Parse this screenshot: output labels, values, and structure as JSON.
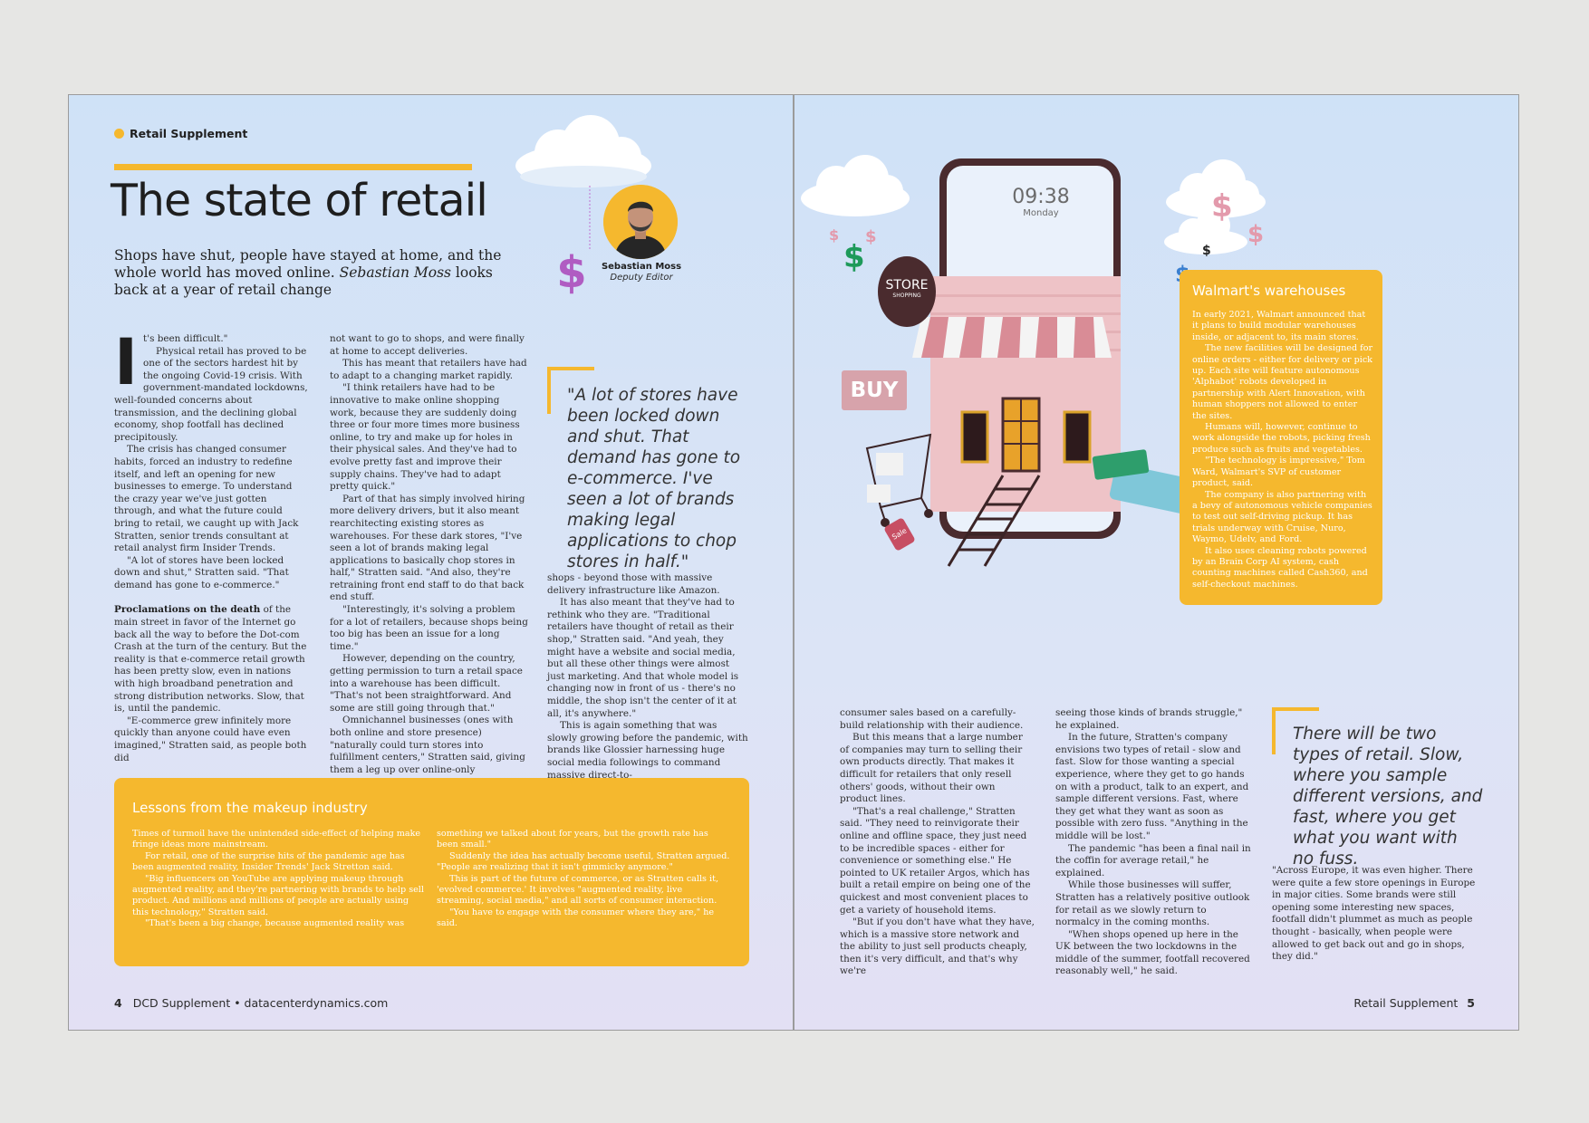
{
  "left": {
    "kicker": "Retail Supplement",
    "title": "The state of retail",
    "standfirst_main": "Shops have shut, people have stayed at home, and the whole world has moved online.",
    "standfirst_author": "Sebastian Moss",
    "standfirst_end": "looks back at a year of retail change",
    "author_name": "Sebastian Moss",
    "author_role": "Deputy Editor",
    "dollar_icon": "dollar-sign",
    "col1": {
      "dropcap": "I",
      "p1": "t's been difficult.\"",
      "p2": "Physical retail has proved to be one of the sectors hardest hit by the ongoing Covid-19 crisis. With government-mandated lockdowns, well-founded concerns about transmission, and the declining global economy, shop footfall has declined precipitously.",
      "p3": "The crisis has changed consumer habits, forced an industry to redefine itself, and left an opening for new businesses to emerge. To understand the crazy year we've just gotten through, and what the future could bring to retail, we caught up with Jack Stratten, senior trends consultant at retail analyst firm Insider Trends.",
      "p4": "\"A lot of stores have been locked down and shut,\" Stratten said. \"That demand has gone to e-commerce.\"",
      "p5_bold": "Proclamations on the death",
      "p5_rest": " of the main street in favor of the Internet go back all the way to before the Dot-com Crash at the turn of the century. But the reality is that e-commerce retail growth has been pretty slow, even in nations with high broadband penetration and strong distribution networks. Slow, that is, until the pandemic.",
      "p6": "\"E-commerce grew infinitely more quickly than anyone could have even imagined,\" Stratten said, as people both did"
    },
    "col2": {
      "p1": "not want to go to shops, and were finally at home to accept deliveries.",
      "p2": "This has meant that retailers have had to adapt to a changing market rapidly.",
      "p3": "\"I think retailers have had to be innovative to make online shopping work, because they are suddenly doing three or four more times more business online, to try and make up for holes in their physical sales. And they've had to evolve pretty fast and improve their supply chains. They've had to adapt pretty quick.\"",
      "p4": "Part of that has simply involved hiring more delivery drivers, but it also meant rearchitecting existing stores as warehouses. For these dark stores, \"I've seen a lot of brands making legal applications to basically chop stores in half,\" Stratten said. \"And also, they're retraining front end staff to do that back end stuff.",
      "p5": "\"Interestingly, it's solving a problem for a lot of retailers, because shops being too big has been an issue for a long time.\"",
      "p6": "However, depending on the country, getting permission to turn a retail space into a warehouse has been difficult. \"That's not been straightforward. And some are still going through that.\"",
      "p7": "Omnichannel businesses (ones with both online and store presence) \"naturally could turn stores into fulfillment centers,\" Stratten said, giving them a leg up over online-only"
    },
    "pullquote": "\"A lot of stores have been locked down and shut. That demand has gone to e-commerce. I've seen a lot of brands making legal applications to chop stores in half.\"",
    "col3": {
      "p1": "shops - beyond those with massive delivery infrastructure like Amazon.",
      "p2": "It has also meant that they've had to rethink who they are. \"Traditional retailers have thought of retail as their shop,\" Stratten said. \"And yeah, they might have a website and social media, but all these other things were almost just marketing. And that whole model is changing now in front of us - there's no middle, the shop isn't the center of it at all, it's anywhere.\"",
      "p3": "This is again something that was slowly growing before the pandemic, with brands like Glossier harnessing huge social media followings to command massive direct-to-"
    },
    "box": {
      "title": "Lessons from the makeup industry",
      "c1p1": "Times of turmoil have the unintended side-effect of helping make fringe ideas more mainstream.",
      "c1p2": "For retail, one of the surprise hits of the pandemic age has been augmented reality, Insider Trends' Jack Stretton said.",
      "c1p3": "\"Big influencers on YouTube are applying makeup through augmented reality, and they're partnering with brands to help sell product. And millions and millions of people are actually using this technology,\" Stratten said.",
      "c1p4": "\"That's been a big change, because augmented reality was",
      "c2p1": "something we talked about for years, but the growth rate has been small.\"",
      "c2p2": "Suddenly the idea has actually become useful, Stratten argued. \"People are realizing that it isn't gimmicky anymore.\"",
      "c2p3": "This is part of the future of commerce, or as Stratten calls it, 'evolved commerce.' It involves \"augmented reality, live streaming, social media,\" and all sorts of consumer interaction.",
      "c2p4": "\"You have to engage with the consumer where they are,\" he said."
    },
    "folio_num": "4",
    "folio_text": "DCD Supplement • datacenterdynamics.com"
  },
  "right": {
    "phone_time": "09:38",
    "phone_day": "Monday",
    "store_sign_main": "STORE",
    "store_sign_sub": "SHOPPING",
    "buy_sign": "BUY",
    "sale_tag": "Sale",
    "box": {
      "title": "Walmart's warehouses",
      "p1": "In early 2021, Walmart announced that it plans to build modular warehouses inside, or adjacent to, its main stores.",
      "p2": "The new facilities will be designed for online orders - either for delivery or pick up. Each site will feature autonomous 'Alphabot' robots developed in partnership with Alert Innovation, with human shoppers not allowed to enter the sites.",
      "p3": "Humans will, however, continue to work alongside the robots, picking fresh produce such as fruits and vegetables.",
      "p4": "\"The technology is impressive,\" Tom Ward, Walmart's SVP of customer product, said.",
      "p5": "The company is also partnering with a bevy of autonomous vehicle companies to test out self-driving pickup. It has trials underway with Cruise, Nuro, Waymo, Udelv, and Ford.",
      "p6": "It also uses cleaning robots powered by an Brain Corp AI system, cash counting machines called Cash360, and self-checkout machines."
    },
    "col1": {
      "p1": "consumer sales based on a carefully-build relationship with their audience.",
      "p2": "But this means that a large number of companies may turn to selling their own products directly. That makes it difficult for retailers that only resell others' goods, without their own product lines.",
      "p3": "\"That's a real challenge,\" Stratten said. \"They need to reinvigorate their online and offline space, they just need to be incredible spaces - either for convenience or something else.\" He pointed to UK retailer Argos, which has built a retail empire on being one of the quickest and most convenient places to get a variety of household items.",
      "p4": "\"But if you don't have what they have, which is a massive store network and the ability to just sell products cheaply, then it's very difficult, and that's why we're"
    },
    "col2": {
      "p1": "seeing those kinds of brands struggle,\" he explained.",
      "p2": "In the future, Stratten's company envisions two types of retail - slow and fast. Slow for those wanting a special experience, where they get to go hands on with a product, talk to an expert, and sample different versions. Fast, where they get what they want as soon as possible with zero fuss. \"Anything in the middle will be lost.\"",
      "p3": "The pandemic \"has been a final nail in the coffin for average retail,\" he explained.",
      "p4": "While those businesses will suffer, Stratten has a relatively positive outlook for retail as we slowly return to normalcy in the coming months.",
      "p5": "\"When shops opened up here in the UK between the two lockdowns in the middle of the summer, footfall recovered reasonably well,\" he said."
    },
    "pullquote": "There will be two types of retail. Slow, where you sample different versions, and fast, where you get what you want with no fuss.",
    "col3": {
      "p1": "\"Across Europe, it was even higher. There were quite a few store openings in Europe in major cities. Some brands were still opening some interesting new spaces, footfall didn't plummet as much as people thought - basically, when people were allowed to get back out and go in shops, they did.\""
    },
    "folio_text": "Retail Supplement",
    "folio_num": "5"
  },
  "colors": {
    "accent": "#f5b82e",
    "page_bg": "#d6e4f6",
    "dollar_purple": "#b05cc2",
    "dollar_green": "#1e9a5a",
    "dollar_blue": "#3a7fd0",
    "dollar_pink": "#e39aac"
  }
}
